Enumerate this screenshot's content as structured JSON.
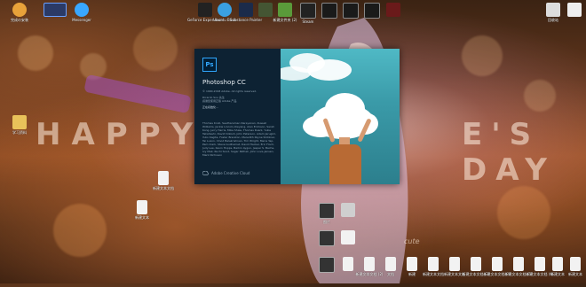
{
  "desktop": {
    "top_icons": [
      {
        "label": "完成の安装",
        "color": "#e8a23a"
      },
      {
        "label": "",
        "color": "#2b3a66"
      },
      {
        "label": "Messenger",
        "color": "#39a7ff"
      },
      {
        "label": "GeForce Experience",
        "color": "#222222"
      },
      {
        "label": "Ubuntu Bash",
        "color": "#3aa0e0"
      },
      {
        "label": "Substance Painter",
        "color": "#1b2b4a"
      },
      {
        "label": "",
        "color": "#445533"
      },
      {
        "label": "新建文件夹 (2)",
        "color": "#5a9a3a"
      },
      {
        "label": "Steam",
        "color": "#222222"
      },
      {
        "label": "",
        "color": "#1a1a1a"
      },
      {
        "label": "",
        "color": "#1a1a1a"
      },
      {
        "label": "",
        "color": "#1a1a1a"
      },
      {
        "label": "",
        "color": "#6a1a1a"
      },
      {
        "label": "回收站",
        "color": "#dddddd"
      },
      {
        "label": "",
        "color": "#eeeeee"
      }
    ],
    "left_icons": [
      {
        "label": "学习资料",
        "color": "#e8c25a"
      }
    ],
    "mid_icons": [
      {
        "label": "新建文本文档",
        "color": "#f2f2f2"
      },
      {
        "label": "新建文本",
        "color": "#f2f2f2"
      }
    ],
    "bottom_icons": [
      {
        "label": "图片",
        "color": "#333333"
      },
      {
        "label": "",
        "color": "#cfcfcf"
      },
      {
        "label": "",
        "color": "#333333"
      },
      {
        "label": "",
        "color": "#f2f2f2"
      },
      {
        "label": "",
        "color": "#333333"
      },
      {
        "label": "",
        "color": "#f2f2f2"
      },
      {
        "label": "新建文本文档 (2)",
        "color": "#f2f2f2"
      },
      {
        "label": "文档",
        "color": "#f2f2f2"
      },
      {
        "label": "新建",
        "color": "#f2f2f2"
      },
      {
        "label": "新建文本文档",
        "color": "#f2f2f2"
      },
      {
        "label": "新建文本文档",
        "color": "#f2f2f2"
      },
      {
        "label": "新建文本文档 (3)",
        "color": "#f2f2f2"
      },
      {
        "label": "新建文本文档 (4)",
        "color": "#f2f2f2"
      },
      {
        "label": "新建文本文档 (5)",
        "color": "#f2f2f2"
      },
      {
        "label": "新建文本文档 (6)",
        "color": "#f2f2f2"
      },
      {
        "label": "新建文本",
        "color": "#f2f2f2"
      },
      {
        "label": "新建文本",
        "color": "#f2f2f2"
      }
    ],
    "wallpaper_text_left": "HAPPY",
    "wallpaper_text_right": "E'S DAY",
    "wallpaper_small_text": "cute"
  },
  "splash": {
    "app_icon": "Ps",
    "app_name": "Photoshop CC",
    "copyright": "© 1990-2018 Adobe. All rights reserved.",
    "user_line1": "Ricardo Sou 先生",
    "user_line2": "感谢您使用正版 Adobe 产品",
    "loading_text": "正在初始化...",
    "credits": "Thomas Knoll, Seetharaman Narayanan, Russell Williams, Jackie Lincoln-Owyang, Alan Erickson, Sarah Kong, Jerry Harris, Mike Shaw, Thomas Ruark, Yukie Takahashi, David Dobish, John Peterson, Adam Jerugim, Yuko Kagita, Foster Brereton, Meredith Payne Stotzner, Tai Luxon, Vinod Balakrishnan, Tim Wright, Maria Yap, Pam Clark, Steve Guilhamet, David Hackel, Eric Floch, Judy Lee, Kevin Hopps, Barkin Aygun, Jesper S. Bache, Ivy Mak, Ruchi Sood, Sagar Pathak, John Love-Jensen, Mark Nichoson",
    "footer": "Adobe Creative Cloud",
    "colors": {
      "left_bg": "#0d2233",
      "accent": "#31a8ff",
      "sky": "#4fb9c5"
    }
  }
}
